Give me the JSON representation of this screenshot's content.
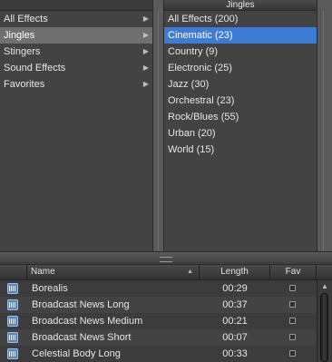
{
  "categories": {
    "items": [
      {
        "label": "All Effects"
      },
      {
        "label": "Jingles"
      },
      {
        "label": "Stingers"
      },
      {
        "label": "Sound Effects"
      },
      {
        "label": "Favorites"
      }
    ],
    "selected_index": 1
  },
  "subcategories": {
    "header": "Jingles",
    "items": [
      {
        "label": "All Effects (200)"
      },
      {
        "label": "Cinematic (23)"
      },
      {
        "label": "Country (9)"
      },
      {
        "label": "Electronic (25)"
      },
      {
        "label": "Jazz (30)"
      },
      {
        "label": "Orchestral (23)"
      },
      {
        "label": "Rock/Blues (55)"
      },
      {
        "label": "Urban (20)"
      },
      {
        "label": "World (15)"
      }
    ],
    "selected_index": 1
  },
  "table": {
    "columns": {
      "name": "Name",
      "length": "Length",
      "fav": "Fav"
    },
    "sort_indicator": "▲",
    "rows": [
      {
        "name": "Borealis",
        "length": "00:29"
      },
      {
        "name": "Broadcast News Long",
        "length": "00:37"
      },
      {
        "name": "Broadcast News Medium",
        "length": "00:21"
      },
      {
        "name": "Broadcast News Short",
        "length": "00:07"
      },
      {
        "name": "Celestial Body Long",
        "length": "00:33"
      }
    ]
  },
  "icons": {
    "row_icon": "audio-waveform-icon",
    "disclosure": "chevron-right-icon",
    "scroll_up": "scroll-up-arrow-icon"
  },
  "colors": {
    "selection_blue": "#3d7cd4",
    "selection_gray": "#707070",
    "background_orange": "#e39a2a"
  }
}
